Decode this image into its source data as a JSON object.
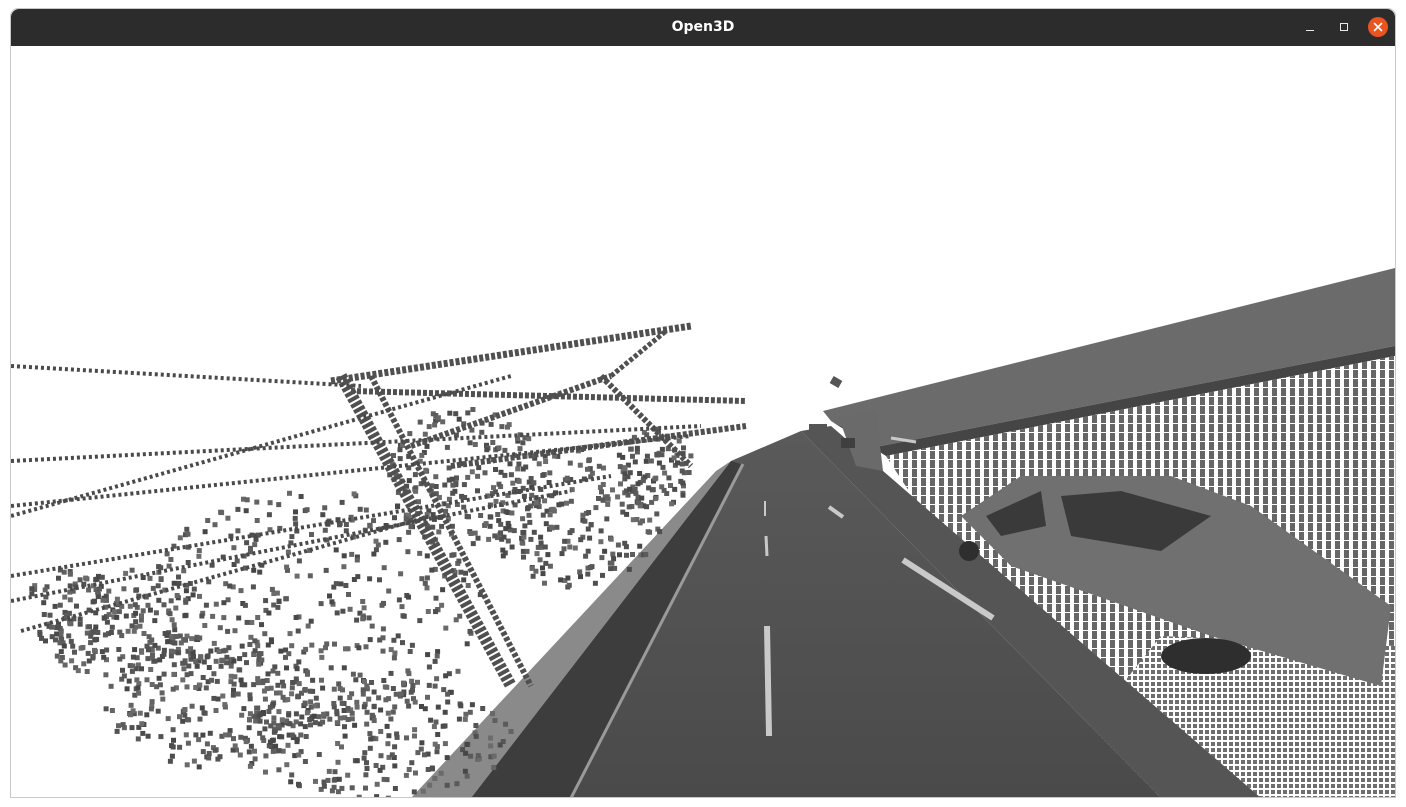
{
  "window": {
    "title": "Open3D",
    "controls": {
      "minimize_icon": "minimize-icon",
      "maximize_icon": "maximize-icon",
      "close_icon": "close-icon",
      "close_color": "#e95420"
    }
  },
  "viewport": {
    "background_color": "#ffffff",
    "content": "point-cloud"
  }
}
